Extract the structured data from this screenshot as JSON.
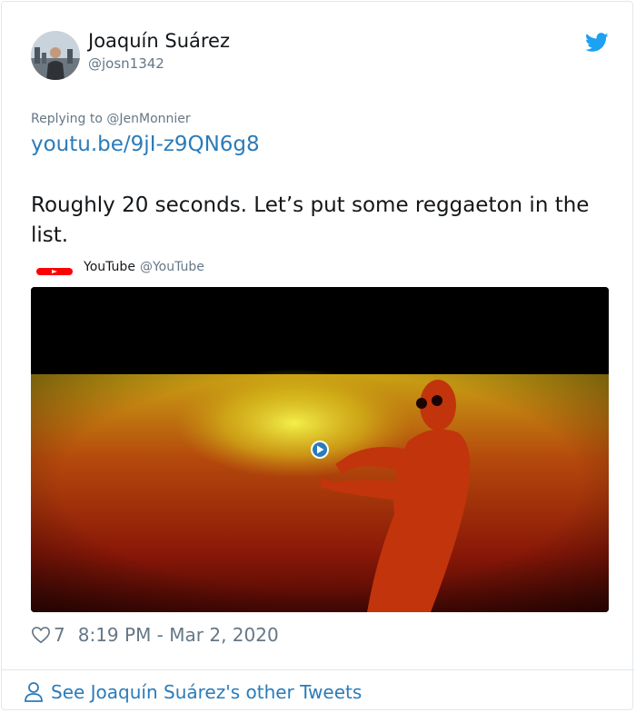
{
  "tweet": {
    "author_name": "Joaquín Suárez",
    "author_handle": "@josn1342",
    "replying_to": "Replying to @JenMonnier",
    "link": "youtu.be/9jI-z9QN6g8",
    "text": "Roughly 20 seconds. Let’s put some reggaeton in the list.",
    "like_count": "7",
    "timestamp": "8:19 PM - Mar 2, 2020"
  },
  "embed": {
    "source_name": "YouTube",
    "source_handle": "@YouTube"
  },
  "footer": {
    "label": "See Joaquín Suárez's other Tweets"
  },
  "colors": {
    "link": "#2b7bb9",
    "twitter_blue": "#1da1f2",
    "muted": "#657786",
    "youtube_red": "#ff0000"
  },
  "icons": [
    "twitter-bird-icon",
    "youtube-logo-icon",
    "play-icon",
    "heart-icon",
    "person-icon"
  ]
}
